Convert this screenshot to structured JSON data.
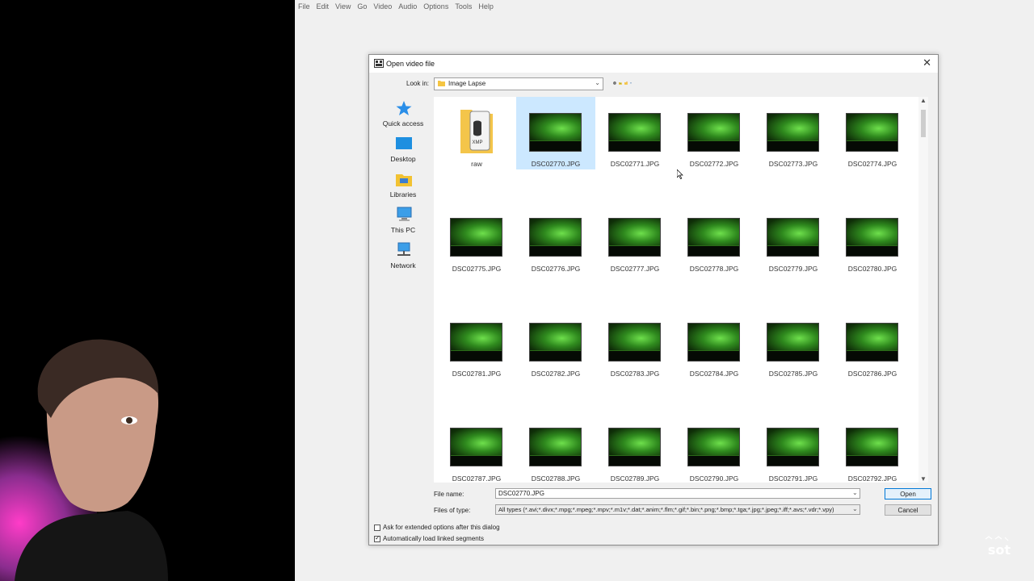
{
  "menubar": [
    "File",
    "Edit",
    "View",
    "Go",
    "Video",
    "Audio",
    "Options",
    "Tools",
    "Help"
  ],
  "dialog": {
    "title": "Open video file",
    "look_in_label": "Look in:",
    "look_in_value": "Image Lapse",
    "places": [
      {
        "label": "Quick access",
        "icon": "star-icon"
      },
      {
        "label": "Desktop",
        "icon": "desktop-icon"
      },
      {
        "label": "Libraries",
        "icon": "libraries-icon"
      },
      {
        "label": "This PC",
        "icon": "computer-icon"
      },
      {
        "label": "Network",
        "icon": "network-icon"
      }
    ],
    "files": [
      {
        "name": "raw",
        "type": "folder"
      },
      {
        "name": "DSC02770.JPG",
        "selected": true
      },
      {
        "name": "DSC02771.JPG"
      },
      {
        "name": "DSC02772.JPG"
      },
      {
        "name": "DSC02773.JPG"
      },
      {
        "name": "DSC02774.JPG"
      },
      {
        "name": "DSC02775.JPG"
      },
      {
        "name": "DSC02776.JPG"
      },
      {
        "name": "DSC02777.JPG"
      },
      {
        "name": "DSC02778.JPG"
      },
      {
        "name": "DSC02779.JPG"
      },
      {
        "name": "DSC02780.JPG"
      },
      {
        "name": "DSC02781.JPG"
      },
      {
        "name": "DSC02782.JPG"
      },
      {
        "name": "DSC02783.JPG"
      },
      {
        "name": "DSC02784.JPG"
      },
      {
        "name": "DSC02785.JPG"
      },
      {
        "name": "DSC02786.JPG"
      },
      {
        "name": "DSC02787.JPG"
      },
      {
        "name": "DSC02788.JPG"
      },
      {
        "name": "DSC02789.JPG"
      },
      {
        "name": "DSC02790.JPG"
      },
      {
        "name": "DSC02791.JPG"
      },
      {
        "name": "DSC02792.JPG"
      }
    ],
    "file_name_label": "File name:",
    "file_name_value": "DSC02770.JPG",
    "files_of_type_label": "Files of type:",
    "files_of_type_value": "All types (*.avi;*.divx;*.mpg;*.mpeg;*.mpv;*.m1v;*.dat;*.anim;*.flm;*.gif;*.bin;*.png;*.bmp;*.tga;*.jpg;*.jpeg;*.iff;*.avs;*.vdr;*.vpy)",
    "open_button": "Open",
    "cancel_button": "Cancel",
    "options": [
      {
        "label": "Ask for extended options after this dialog",
        "checked": false
      },
      {
        "label": "Automatically load linked segments",
        "checked": true
      }
    ]
  },
  "colors": {
    "selection": "#cce8ff",
    "accent": "#0078d7"
  }
}
